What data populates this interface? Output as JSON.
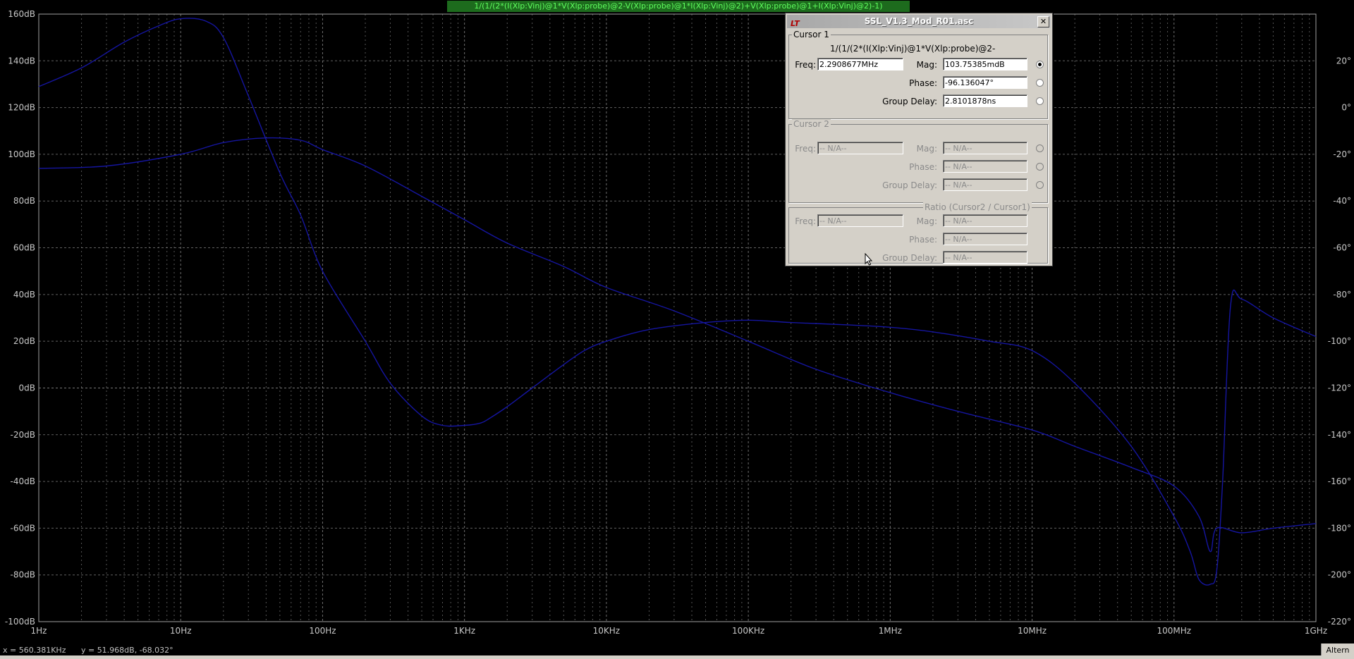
{
  "window": {
    "trace_expression": "1/(1/(2*(I(Xlp:Vinj)@1*V(Xlp:probe)@2-V(Xlp:probe)@1*I(Xlp:Vinj)@2)+V(Xlp:probe)@1+I(Xlp:Vinj)@2)-1)"
  },
  "chart_data": {
    "type": "line",
    "title": "1/(1/(2*(I(Xlp:Vinj)@1*V(Xlp:probe)@2-V(Xlp:probe)@1*I(Xlp:Vinj)@2)+V(Xlp:probe)@1+I(Xlp:Vinj)@2)-1)",
    "x_scale": "log",
    "x_ticks": [
      "1Hz",
      "10Hz",
      "100Hz",
      "1KHz",
      "10KHz",
      "100KHz",
      "1MHz",
      "10MHz",
      "100MHz",
      "1GHz"
    ],
    "y_ticks": [
      "160dB",
      "140dB",
      "120dB",
      "100dB",
      "80dB",
      "60dB",
      "40dB",
      "20dB",
      "0dB",
      "-20dB",
      "-40dB",
      "-60dB",
      "-80dB",
      "-100dB"
    ],
    "y2_ticks": [
      "20°",
      "0°",
      "-20°",
      "-40°",
      "-60°",
      "-80°",
      "-100°",
      "-120°",
      "-140°",
      "-160°",
      "-180°",
      "-200°",
      "-220°"
    ],
    "xlim_hz": [
      1,
      1000000000
    ],
    "ylim_db": [
      -100,
      160
    ],
    "y2lim_deg": [
      -220,
      40
    ],
    "grid": true,
    "trace_color": "#1515a0",
    "grid_color": "#7a7a7a",
    "label_color": "#c8c8c8",
    "series": [
      {
        "axis": "magnitude_db",
        "x_hz": [
          1,
          2,
          4,
          7,
          10,
          15,
          20,
          30,
          50,
          70,
          100,
          200,
          300,
          500,
          700,
          1000,
          1300,
          1500,
          2000,
          3000,
          5000,
          7000,
          10000,
          20000,
          50000,
          100000,
          200000,
          500000,
          1000000,
          2000000,
          5000000,
          10000000,
          20000000,
          50000000,
          100000000,
          130000000,
          150000000,
          180000000,
          200000000,
          220000000,
          250000000,
          300000000,
          500000000,
          1000000000
        ],
        "y": [
          129,
          137,
          148,
          155,
          158,
          157,
          150,
          125,
          92,
          74,
          50,
          20,
          2,
          -12,
          -16,
          -16,
          -15,
          -13,
          -8,
          0,
          10,
          16,
          20,
          25,
          28,
          29,
          28,
          27,
          26,
          24,
          20,
          16,
          2,
          -25,
          -55,
          -70,
          -82,
          -84,
          -78,
          -40,
          35,
          38,
          30,
          22
        ]
      },
      {
        "axis": "phase_deg",
        "x_hz": [
          1,
          3,
          10,
          20,
          40,
          70,
          100,
          200,
          500,
          1000,
          2000,
          5000,
          10000,
          30000,
          100000,
          300000,
          1000000,
          3000000,
          10000000,
          20000000,
          50000000,
          100000000,
          150000000,
          180000000,
          200000000,
          300000000,
          500000000,
          1000000000
        ],
        "y": [
          -26,
          -25,
          -20,
          -15,
          -13,
          -14,
          -18,
          -25,
          -38,
          -48,
          -58,
          -68,
          -77,
          -87,
          -100,
          -112,
          -122,
          -130,
          -138,
          -145,
          -154,
          -162,
          -175,
          -190,
          -180,
          -182,
          -180,
          -178
        ]
      }
    ]
  },
  "cursor_dialog": {
    "title": "SSL_V1.3_Mod_R01.asc",
    "cursor1": {
      "legend": "Cursor 1",
      "expression": "1/(1/(2*(I(Xlp:Vinj)@1*V(Xlp:probe)@2-",
      "freq_label": "Freq:",
      "freq_value": "2.2908677MHz",
      "mag_label": "Mag:",
      "mag_value": "103.75385mdB",
      "phase_label": "Phase:",
      "phase_value": "-96.136047°",
      "gd_label": "Group Delay:",
      "gd_value": "2.8101878ns"
    },
    "cursor2": {
      "legend": "Cursor 2",
      "freq_label": "Freq:",
      "freq_value": "-- N/A--",
      "mag_label": "Mag:",
      "mag_value": "-- N/A--",
      "phase_label": "Phase:",
      "phase_value": "-- N/A--",
      "gd_label": "Group Delay:",
      "gd_value": "-- N/A--"
    },
    "ratio": {
      "legend": "Ratio (Cursor2 / Cursor1)",
      "freq_label": "Freq:",
      "freq_value": "-- N/A--",
      "mag_label": "Mag:",
      "mag_value": "-- N/A--",
      "phase_label": "Phase:",
      "phase_value": "-- N/A--",
      "gd_label": "Group Delay:",
      "gd_value": "-- N/A--"
    }
  },
  "status_bar": {
    "x_readout": "x = 560.381KHz",
    "y_readout": "y = 51.968dB, -68.032°",
    "mode": "Altern"
  }
}
